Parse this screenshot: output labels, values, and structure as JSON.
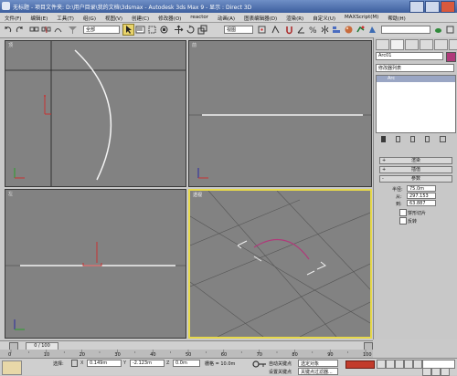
{
  "window": {
    "app_name": "无标题",
    "title": "- 项目文件夹: D:\\用户目录\\我的文档\\3dsmax - Autodesk 3ds Max 9 - 显示 : Direct 3D"
  },
  "menu": [
    "文件(F)",
    "编辑(E)",
    "工具(T)",
    "组(G)",
    "视图(V)",
    "创建(C)",
    "修改器(O)",
    "reactor",
    "动画(A)",
    "图表编辑器(D)",
    "渲染(R)",
    "自定义(U)",
    "MAXScript(M)",
    "帮助(H)"
  ],
  "toolbar": {
    "selection_filter": "全部",
    "coord_system": "视图"
  },
  "viewports": {
    "top": "顶",
    "front": "前",
    "left": "左",
    "perspective": "透视"
  },
  "command_panel": {
    "object_name": "Arc01",
    "modifier_list": "修改器列表",
    "stack_item": "Arc",
    "rollouts": {
      "rendering": "渲染",
      "interpolation": "插值",
      "parameters": "参数"
    },
    "params": {
      "radius_label": "半径:",
      "radius_value": "75.0m",
      "from_label": "从:",
      "from_value": "297.153",
      "to_label": "到:",
      "to_value": "63.887",
      "pie_slice": "饼形切片",
      "reverse": "反转"
    },
    "colors": {
      "swatch": "#b03a7a"
    }
  },
  "timeline": {
    "frame_display": "0 / 100",
    "ticks": [
      "0",
      "10",
      "20",
      "30",
      "40",
      "50",
      "60",
      "70",
      "80",
      "90",
      "100"
    ]
  },
  "status": {
    "selection_label": "选择:",
    "x_value": "0.149m",
    "y_value": "-2.123m",
    "z_value": "0.0m",
    "grid": "栅格 = 10.0m",
    "auto_key": "自动关键点",
    "selected_dropdown": "选定对象",
    "set_key": "设置关键点",
    "key_filters": "关键点过滤器..."
  }
}
